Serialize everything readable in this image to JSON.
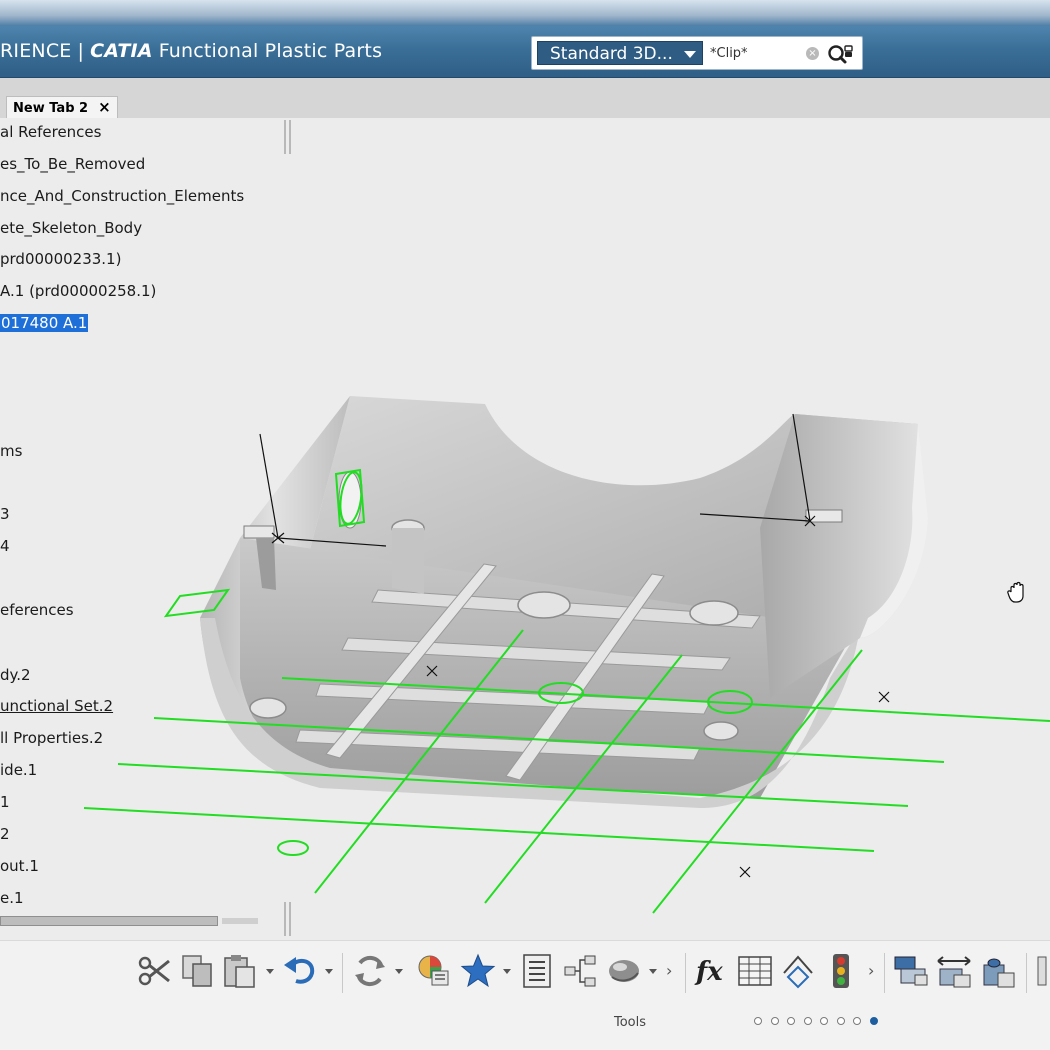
{
  "header": {
    "title_prefix": "RIENCE",
    "title_sep": "|",
    "title_brand": "CATIA",
    "title_app": "Functional Plastic Parts"
  },
  "search": {
    "scope": "Standard 3D...",
    "value": "*Clip*",
    "clear_icon": "clear-icon",
    "search_icon": "search-icon"
  },
  "tabs": [
    {
      "label": "New Tab 2",
      "close": "×"
    }
  ],
  "tree": {
    "items": [
      {
        "label": "al References"
      },
      {
        "label": "es_To_Be_Removed"
      },
      {
        "label": "nce_And_Construction_Elements"
      },
      {
        "label": "ete_Skeleton_Body"
      },
      {
        "label": "prd00000233.1)"
      },
      {
        "label": "A.1 (prd00000258.1)"
      },
      {
        "label": "017480 A.1",
        "selected": true
      },
      {
        "label": "ms"
      },
      {
        "label": "3"
      },
      {
        "label": "4"
      },
      {
        "label": "eferences"
      },
      {
        "label": "dy.2"
      },
      {
        "label": "unctional Set.2",
        "underlined": true
      },
      {
        "label": "ll Properties.2"
      },
      {
        "label": "ide.1"
      },
      {
        "label": "1"
      },
      {
        "label": "2"
      },
      {
        "label": "out.1"
      },
      {
        "label": "e.1"
      }
    ]
  },
  "toolbar": {
    "icons": [
      "cut-icon",
      "copy-icon",
      "paste-icon",
      "undo-icon",
      "update-icon",
      "material-icon",
      "favorite-star-icon",
      "report-list-icon",
      "tree-graph-icon",
      "render-style-icon",
      "formula-fx-icon",
      "table-icon",
      "measure-icon",
      "traffic-light-icon",
      "tool-a-icon",
      "tool-b-icon",
      "tool-c-icon"
    ],
    "section_label": "Tools",
    "page_count": 8,
    "active_page": 8
  },
  "colors": {
    "title_bar": "#3a6f98",
    "selection": "#1e6fd8",
    "sketch_green": "#22dd22",
    "part_gray": "#b8b8b8"
  }
}
